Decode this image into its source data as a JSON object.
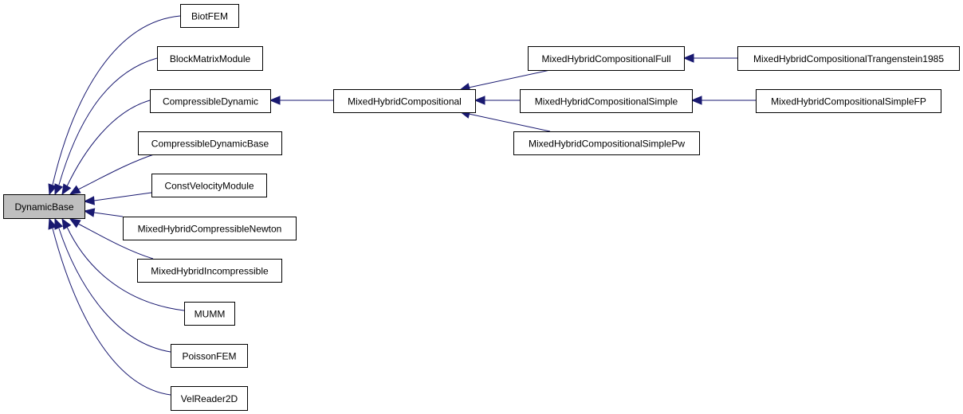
{
  "diagram": {
    "type": "inheritance-graph",
    "colors": {
      "edge": "#191970",
      "root_fill": "#bfbfbf",
      "node_fill": "#ffffff",
      "border": "#000000"
    },
    "nodes": [
      {
        "id": "DynamicBase",
        "label": "DynamicBase",
        "root": true
      },
      {
        "id": "BiotFEM",
        "label": "BiotFEM"
      },
      {
        "id": "BlockMatrixModule",
        "label": "BlockMatrixModule"
      },
      {
        "id": "CompressibleDynamic",
        "label": "CompressibleDynamic"
      },
      {
        "id": "CompressibleDynamicBase",
        "label": "CompressibleDynamicBase"
      },
      {
        "id": "ConstVelocityModule",
        "label": "ConstVelocityModule"
      },
      {
        "id": "MixedHybridCompressibleNewton",
        "label": "MixedHybridCompressibleNewton"
      },
      {
        "id": "MixedHybridIncompressible",
        "label": "MixedHybridIncompressible"
      },
      {
        "id": "MUMM",
        "label": "MUMM"
      },
      {
        "id": "PoissonFEM",
        "label": "PoissonFEM"
      },
      {
        "id": "VelReader2D",
        "label": "VelReader2D"
      },
      {
        "id": "MixedHybridCompositional",
        "label": "MixedHybridCompositional"
      },
      {
        "id": "MixedHybridCompositionalFull",
        "label": "MixedHybridCompositionalFull"
      },
      {
        "id": "MixedHybridCompositionalSimple",
        "label": "MixedHybridCompositionalSimple"
      },
      {
        "id": "MixedHybridCompositionalSimplePw",
        "label": "MixedHybridCompositionalSimplePw"
      },
      {
        "id": "MixedHybridCompositionalTrangenstein1985",
        "label": "MixedHybridCompositionalTrangenstein1985"
      },
      {
        "id": "MixedHybridCompositionalSimpleFP",
        "label": "MixedHybridCompositionalSimpleFP"
      }
    ],
    "edges": [
      {
        "from": "BiotFEM",
        "to": "DynamicBase"
      },
      {
        "from": "BlockMatrixModule",
        "to": "DynamicBase"
      },
      {
        "from": "CompressibleDynamic",
        "to": "DynamicBase"
      },
      {
        "from": "CompressibleDynamicBase",
        "to": "DynamicBase"
      },
      {
        "from": "ConstVelocityModule",
        "to": "DynamicBase"
      },
      {
        "from": "MixedHybridCompressibleNewton",
        "to": "DynamicBase"
      },
      {
        "from": "MixedHybridIncompressible",
        "to": "DynamicBase"
      },
      {
        "from": "MUMM",
        "to": "DynamicBase"
      },
      {
        "from": "PoissonFEM",
        "to": "DynamicBase"
      },
      {
        "from": "VelReader2D",
        "to": "DynamicBase"
      },
      {
        "from": "MixedHybridCompositional",
        "to": "CompressibleDynamic"
      },
      {
        "from": "MixedHybridCompositionalFull",
        "to": "MixedHybridCompositional"
      },
      {
        "from": "MixedHybridCompositionalSimple",
        "to": "MixedHybridCompositional"
      },
      {
        "from": "MixedHybridCompositionalSimplePw",
        "to": "MixedHybridCompositional"
      },
      {
        "from": "MixedHybridCompositionalTrangenstein1985",
        "to": "MixedHybridCompositionalFull"
      },
      {
        "from": "MixedHybridCompositionalSimpleFP",
        "to": "MixedHybridCompositionalSimple"
      }
    ]
  }
}
